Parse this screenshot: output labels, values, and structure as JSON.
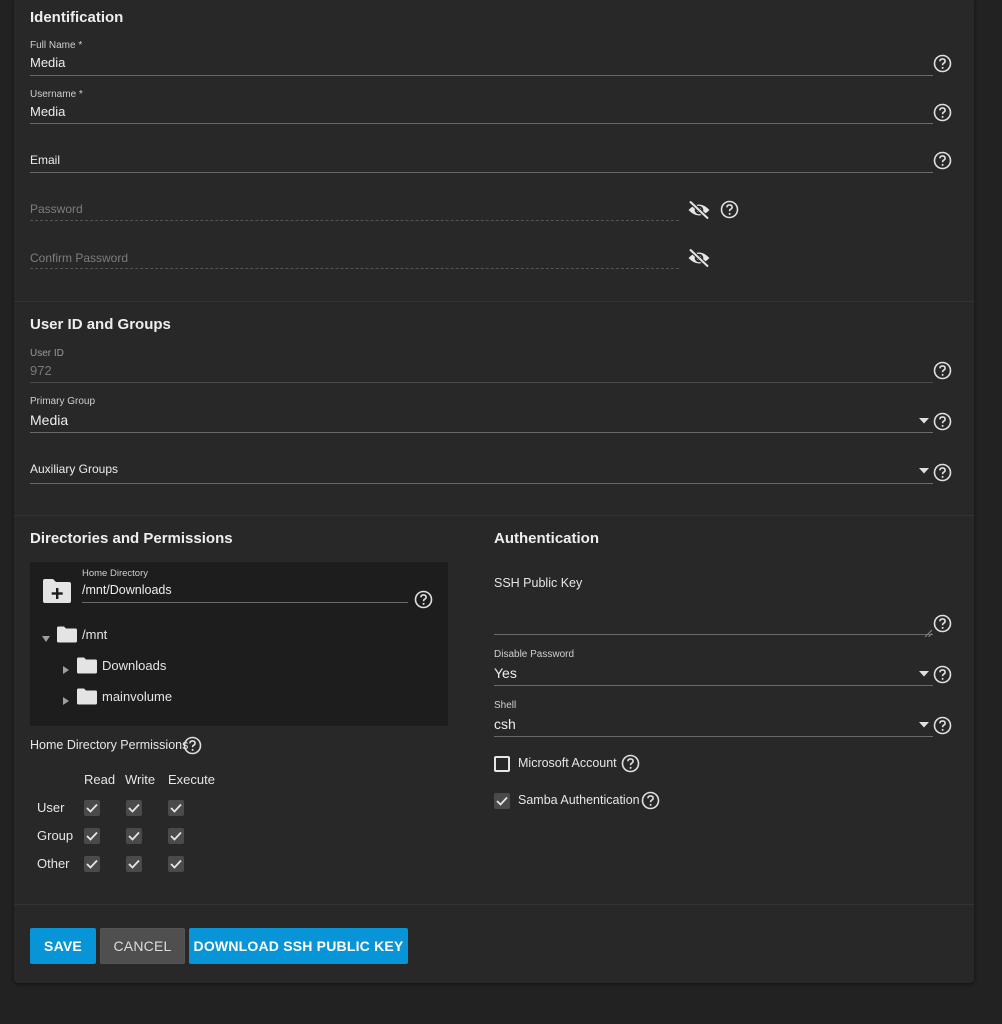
{
  "identification": {
    "title": "Identification",
    "full_name": {
      "label": "Full Name *",
      "value": "Media"
    },
    "username": {
      "label": "Username *",
      "value": "Media"
    },
    "email": {
      "label": "Email"
    },
    "password": {
      "placeholder": "Password"
    },
    "confirm_password": {
      "placeholder": "Confirm Password"
    }
  },
  "user_id_groups": {
    "title": "User ID and Groups",
    "user_id": {
      "label": "User ID",
      "value": "972"
    },
    "primary_group": {
      "label": "Primary Group",
      "value": "Media"
    },
    "auxiliary_groups": {
      "label": "Auxiliary Groups"
    }
  },
  "directories": {
    "title": "Directories and Permissions",
    "home_directory": {
      "label": "Home Directory",
      "value": "/mnt/Downloads"
    },
    "tree": {
      "root": "/mnt",
      "children": [
        "Downloads",
        "mainvolume"
      ]
    },
    "permissions": {
      "title": "Home Directory Permissions",
      "columns": [
        "Read",
        "Write",
        "Execute"
      ],
      "rows": [
        {
          "name": "User",
          "read": true,
          "write": true,
          "execute": true
        },
        {
          "name": "Group",
          "read": true,
          "write": true,
          "execute": true
        },
        {
          "name": "Other",
          "read": true,
          "write": true,
          "execute": true
        }
      ]
    }
  },
  "authentication": {
    "title": "Authentication",
    "ssh_public_key": {
      "label": "SSH Public Key"
    },
    "disable_password": {
      "label": "Disable Password",
      "value": "Yes"
    },
    "shell": {
      "label": "Shell",
      "value": "csh"
    },
    "microsoft_account": {
      "label": "Microsoft Account",
      "checked": false
    },
    "samba_authentication": {
      "label": "Samba Authentication",
      "checked": true
    }
  },
  "actions": {
    "save": "SAVE",
    "cancel": "CANCEL",
    "download_ssh": "DOWNLOAD SSH PUBLIC KEY"
  },
  "colors": {
    "accent": "#0895d8",
    "background": "#222222",
    "card": "#282828"
  }
}
